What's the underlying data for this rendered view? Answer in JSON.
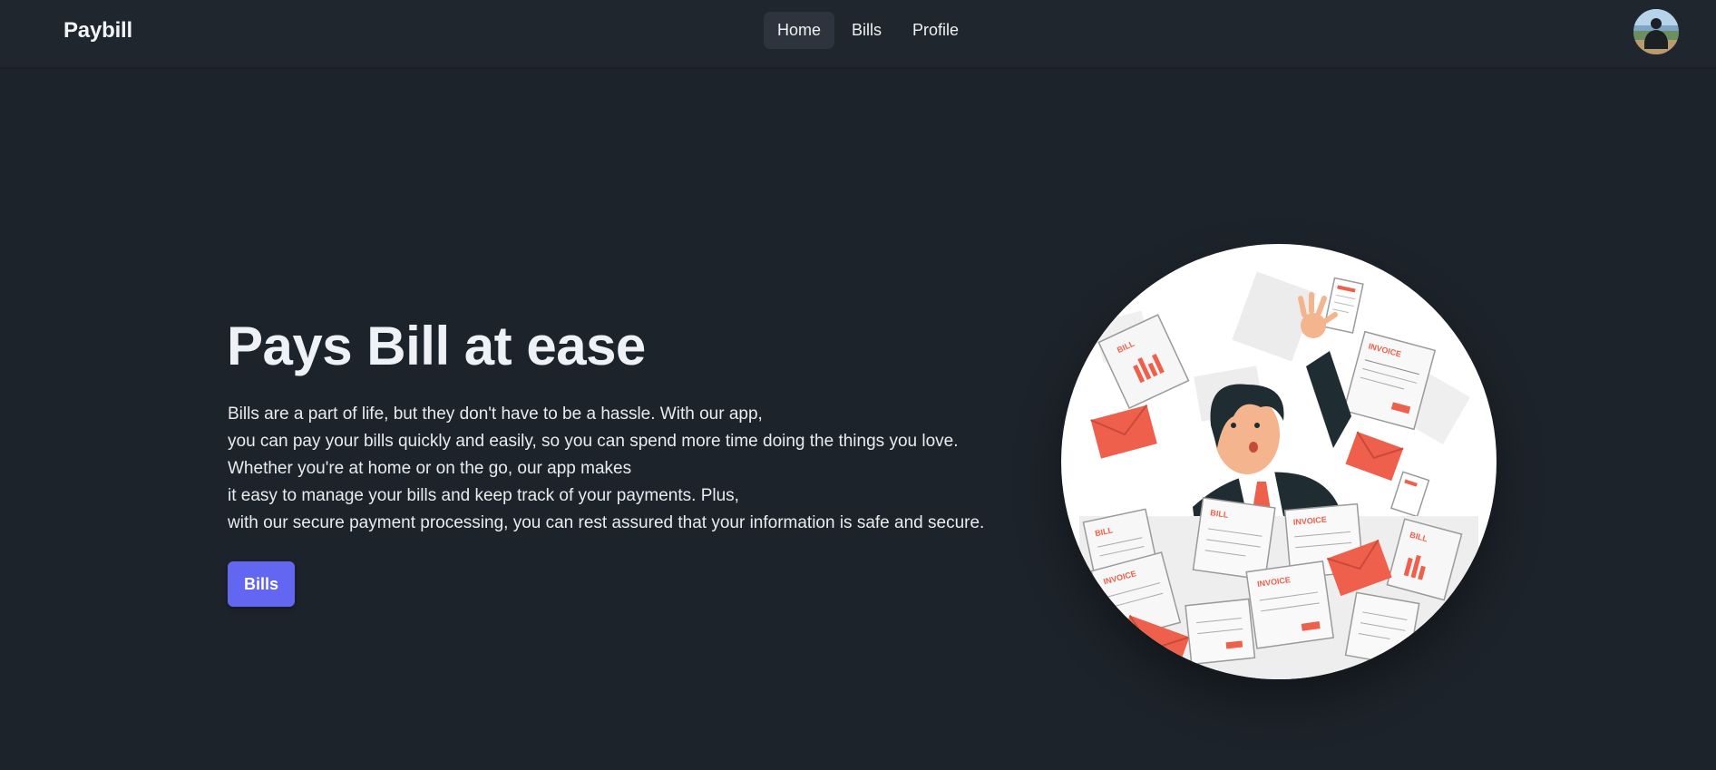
{
  "navbar": {
    "brand": "Paybill",
    "items": [
      {
        "label": "Home",
        "active": true
      },
      {
        "label": "Bills",
        "active": false
      },
      {
        "label": "Profile",
        "active": false
      }
    ]
  },
  "hero": {
    "title": "Pays Bill at ease",
    "lines": [
      "Bills are a part of life, but they don't have to be a hassle. With our app,",
      "you can pay your bills quickly and easily, so you can spend more time doing the things you love.",
      "Whether you're at home or on the go, our app makes",
      "it easy to manage your bills and keep track of your payments. Plus,",
      "with our secure payment processing, you can rest assured that your information is safe and secure."
    ],
    "button_label": "Bills",
    "illustration_labels": {
      "bill": "BILL",
      "invoice": "INVOICE"
    }
  },
  "colors": {
    "background": "#1d232a",
    "navbar": "#20262e",
    "accent": "#6266f1",
    "illustration_red": "#ee5f4c",
    "suit": "#1f2d33"
  },
  "icons": {
    "avatar": "user-avatar"
  }
}
